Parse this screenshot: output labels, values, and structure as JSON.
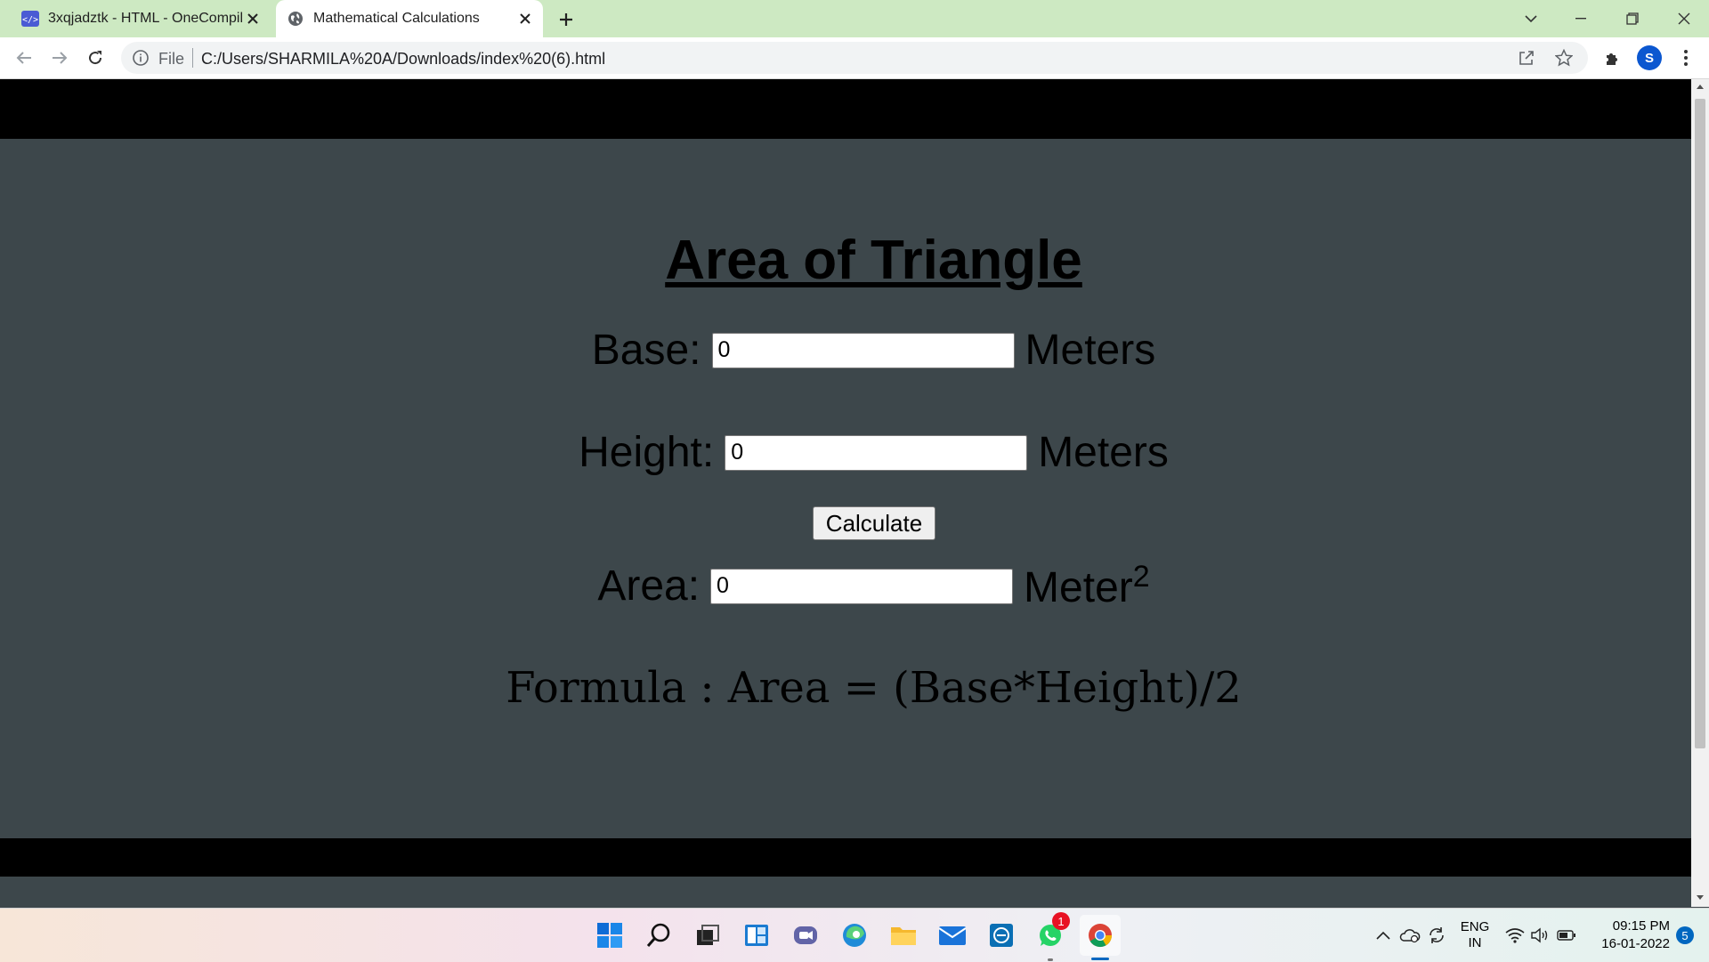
{
  "browser": {
    "tabs": [
      {
        "label": "3xqjadztk - HTML - OneCompiler",
        "icon": "code-icon"
      },
      {
        "label": "Mathematical Calculations",
        "icon": "globe-icon",
        "active": true
      }
    ],
    "address": {
      "scheme_label": "File",
      "url": "C:/Users/SHARMILA%20A/Downloads/index%20(6).html"
    },
    "profile_initial": "S"
  },
  "page": {
    "heading": "Area of Triangle",
    "base": {
      "label": "Base:",
      "value": "0",
      "unit": "Meters"
    },
    "height": {
      "label": "Height:",
      "value": "0",
      "unit": "Meters"
    },
    "calculate_label": "Calculate",
    "area": {
      "label": "Area:",
      "value": "0",
      "unit": "Meter",
      "unit_sup": "2"
    },
    "formula": "Formula : Area = (Base*Height)/2"
  },
  "taskbar": {
    "apps": [
      "start-icon",
      "search-icon",
      "task-view-icon",
      "widgets-icon",
      "teams-chat-icon",
      "edge-icon",
      "file-explorer-icon",
      "mail-icon",
      "dell-app-icon",
      "whatsapp-icon",
      "chrome-icon"
    ],
    "whatsapp_badge": "1",
    "lang_line1": "ENG",
    "lang_line2": "IN",
    "time": "09:15 PM",
    "date": "16-01-2022",
    "notification_count": "5"
  },
  "colors": {
    "page_bg": "#3d474b",
    "band": "#000000",
    "tabstrip": "#cde9c2"
  }
}
